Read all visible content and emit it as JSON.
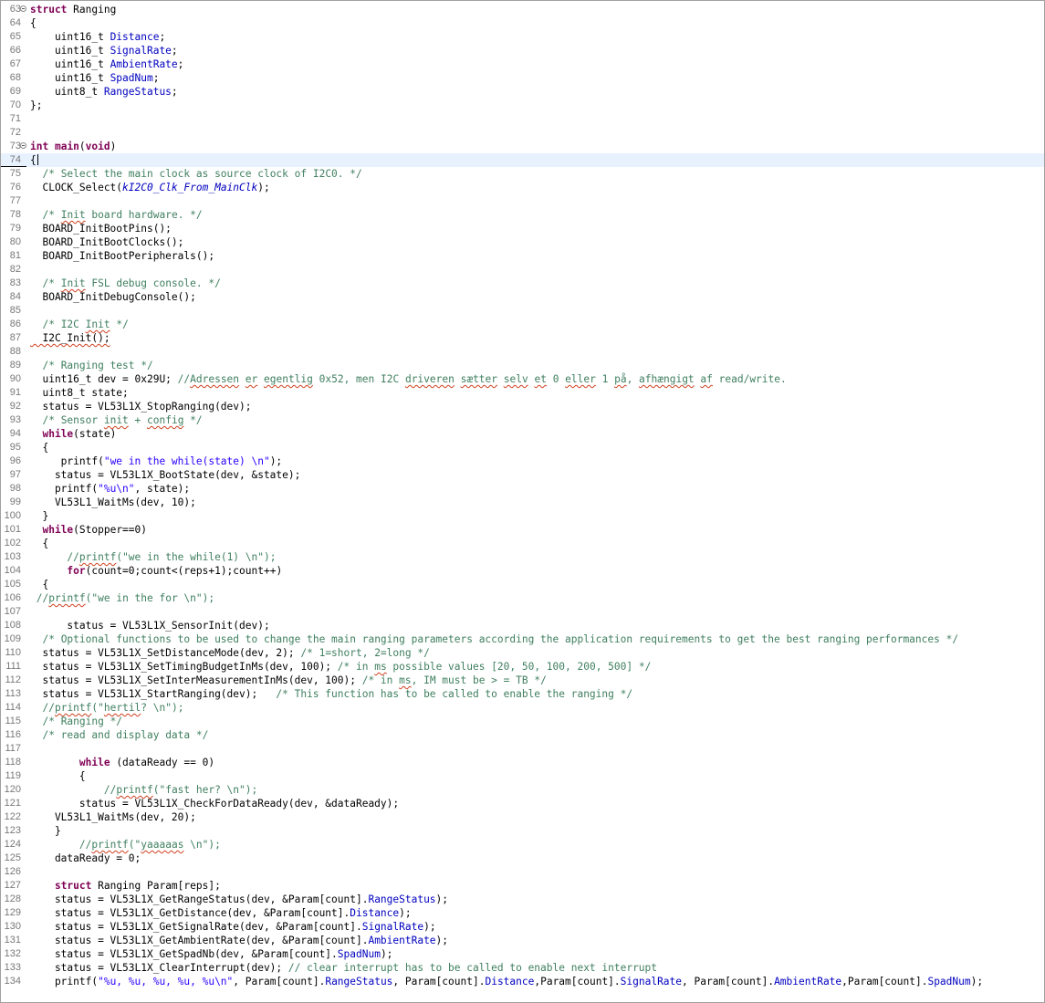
{
  "editor": {
    "current_line": 74,
    "lines": [
      {
        "n": "63",
        "fold": true,
        "t": [
          [
            "k",
            "struct"
          ],
          [
            "p",
            " Ranging"
          ]
        ]
      },
      {
        "n": "64",
        "t": [
          [
            "p",
            "{"
          ]
        ]
      },
      {
        "n": "65",
        "t": [
          [
            "p",
            "    uint16_t "
          ],
          [
            "f",
            "Distance"
          ],
          [
            "p",
            ";"
          ]
        ]
      },
      {
        "n": "66",
        "t": [
          [
            "p",
            "    uint16_t "
          ],
          [
            "f",
            "SignalRate"
          ],
          [
            "p",
            ";"
          ]
        ]
      },
      {
        "n": "67",
        "t": [
          [
            "p",
            "    uint16_t "
          ],
          [
            "f",
            "AmbientRate"
          ],
          [
            "p",
            ";"
          ]
        ]
      },
      {
        "n": "68",
        "t": [
          [
            "p",
            "    uint16_t "
          ],
          [
            "f",
            "SpadNum"
          ],
          [
            "p",
            ";"
          ]
        ]
      },
      {
        "n": "69",
        "t": [
          [
            "p",
            "    uint8_t "
          ],
          [
            "f",
            "RangeStatus"
          ],
          [
            "p",
            ";"
          ]
        ]
      },
      {
        "n": "70",
        "t": [
          [
            "p",
            "};"
          ]
        ]
      },
      {
        "n": "71",
        "t": []
      },
      {
        "n": "72",
        "t": []
      },
      {
        "n": "73",
        "fold": true,
        "t": [
          [
            "k",
            "int"
          ],
          [
            "p",
            " "
          ],
          [
            "k",
            "main"
          ],
          [
            "p",
            "("
          ],
          [
            "k",
            "void"
          ],
          [
            "p",
            ")"
          ]
        ]
      },
      {
        "n": "74",
        "bar": true,
        "caret": true,
        "t": [
          [
            "p",
            "{"
          ]
        ]
      },
      {
        "n": "75",
        "t": [
          [
            "p",
            "  "
          ],
          [
            "c",
            "/* Select the main clock as source clock of I2C0. */"
          ]
        ]
      },
      {
        "n": "76",
        "t": [
          [
            "p",
            "  CLOCK_Select("
          ],
          [
            "i",
            "kI2C0_Clk_From_MainClk"
          ],
          [
            "p",
            ");"
          ]
        ]
      },
      {
        "n": "77",
        "t": []
      },
      {
        "n": "78",
        "t": [
          [
            "p",
            "  "
          ],
          [
            "c",
            "/* "
          ],
          [
            "cw",
            "Init"
          ],
          [
            "c",
            " board hardware. */"
          ]
        ]
      },
      {
        "n": "79",
        "t": [
          [
            "p",
            "  BOARD_InitBootPins();"
          ]
        ]
      },
      {
        "n": "80",
        "t": [
          [
            "p",
            "  BOARD_InitBootClocks();"
          ]
        ]
      },
      {
        "n": "81",
        "t": [
          [
            "p",
            "  BOARD_InitBootPeripherals();"
          ]
        ]
      },
      {
        "n": "82",
        "t": []
      },
      {
        "n": "83",
        "t": [
          [
            "p",
            "  "
          ],
          [
            "c",
            "/* "
          ],
          [
            "cw",
            "Init"
          ],
          [
            "c",
            " FSL debug console. */"
          ]
        ]
      },
      {
        "n": "84",
        "t": [
          [
            "p",
            "  BOARD_InitDebugConsole();"
          ]
        ]
      },
      {
        "n": "85",
        "t": []
      },
      {
        "n": "86",
        "t": [
          [
            "p",
            "  "
          ],
          [
            "c",
            "/* I2C "
          ],
          [
            "cw",
            "Init"
          ],
          [
            "c",
            " */"
          ]
        ]
      },
      {
        "n": "87",
        "t": [
          [
            "pw",
            "  I2C_Init();"
          ]
        ]
      },
      {
        "n": "88",
        "t": []
      },
      {
        "n": "89",
        "t": [
          [
            "p",
            "  "
          ],
          [
            "c",
            "/* Ranging test */"
          ]
        ]
      },
      {
        "n": "90",
        "t": [
          [
            "p",
            "  uint16_t dev = 0x29U; "
          ],
          [
            "c",
            "//"
          ],
          [
            "cw",
            "Adressen"
          ],
          [
            "c",
            " "
          ],
          [
            "cw",
            "er"
          ],
          [
            "c",
            " "
          ],
          [
            "cw",
            "egentlig"
          ],
          [
            "c",
            " 0x52, men I2C "
          ],
          [
            "cw",
            "driveren"
          ],
          [
            "c",
            " "
          ],
          [
            "cw",
            "sætter"
          ],
          [
            "c",
            " "
          ],
          [
            "cw",
            "selv"
          ],
          [
            "c",
            " "
          ],
          [
            "cw",
            "et"
          ],
          [
            "c",
            " 0 "
          ],
          [
            "cw",
            "eller"
          ],
          [
            "c",
            " 1 "
          ],
          [
            "cw",
            "på"
          ],
          [
            "c",
            ", "
          ],
          [
            "cw",
            "afhængigt"
          ],
          [
            "c",
            " "
          ],
          [
            "cw",
            "af"
          ],
          [
            "c",
            " read/write."
          ]
        ]
      },
      {
        "n": "91",
        "t": [
          [
            "p",
            "  uint8_t state;"
          ]
        ]
      },
      {
        "n": "92",
        "t": [
          [
            "p",
            "  status = VL53L1X_StopRanging(dev);"
          ]
        ]
      },
      {
        "n": "93",
        "t": [
          [
            "p",
            "  "
          ],
          [
            "c",
            "/* Sensor "
          ],
          [
            "cw",
            "init"
          ],
          [
            "c",
            " + "
          ],
          [
            "cw",
            "config"
          ],
          [
            "c",
            " */"
          ]
        ]
      },
      {
        "n": "94",
        "t": [
          [
            "p",
            "  "
          ],
          [
            "k",
            "while"
          ],
          [
            "p",
            "(state)"
          ]
        ]
      },
      {
        "n": "95",
        "t": [
          [
            "p",
            "  {"
          ]
        ]
      },
      {
        "n": "96",
        "t": [
          [
            "p",
            "     printf("
          ],
          [
            "s",
            "\"we in the while(state) \\n\""
          ],
          [
            "p",
            ");"
          ]
        ]
      },
      {
        "n": "97",
        "t": [
          [
            "p",
            "    status = VL53L1X_BootState(dev, &state);"
          ]
        ]
      },
      {
        "n": "98",
        "t": [
          [
            "p",
            "    printf("
          ],
          [
            "s",
            "\"%u\\n\""
          ],
          [
            "p",
            ", state);"
          ]
        ]
      },
      {
        "n": "99",
        "t": [
          [
            "p",
            "    VL53L1_WaitMs(dev, 10);"
          ]
        ]
      },
      {
        "n": "100",
        "t": [
          [
            "p",
            "  }"
          ]
        ]
      },
      {
        "n": "101",
        "t": [
          [
            "p",
            "  "
          ],
          [
            "k",
            "while"
          ],
          [
            "p",
            "(Stopper==0)"
          ]
        ]
      },
      {
        "n": "102",
        "t": [
          [
            "p",
            "  {"
          ]
        ]
      },
      {
        "n": "103",
        "t": [
          [
            "p",
            "      "
          ],
          [
            "c",
            "//"
          ],
          [
            "cw",
            "printf"
          ],
          [
            "c",
            "(\"we in the while(1) \\n\");"
          ]
        ]
      },
      {
        "n": "104",
        "t": [
          [
            "p",
            "      "
          ],
          [
            "k",
            "for"
          ],
          [
            "p",
            "(count=0;count<(reps+1);count++)"
          ]
        ]
      },
      {
        "n": "105",
        "t": [
          [
            "p",
            "  {"
          ]
        ]
      },
      {
        "n": "106",
        "t": [
          [
            "p",
            " "
          ],
          [
            "c",
            "//"
          ],
          [
            "cw",
            "printf"
          ],
          [
            "c",
            "(\"we in the for \\n\");"
          ]
        ]
      },
      {
        "n": "107",
        "t": []
      },
      {
        "n": "108",
        "t": [
          [
            "p",
            "      status = VL53L1X_SensorInit(dev);"
          ]
        ]
      },
      {
        "n": "109",
        "t": [
          [
            "p",
            "  "
          ],
          [
            "c",
            "/* Optional functions to be used to change the main ranging parameters according the application requirements to get the best ranging performances */"
          ]
        ]
      },
      {
        "n": "110",
        "t": [
          [
            "p",
            "  status = VL53L1X_SetDistanceMode(dev, 2); "
          ],
          [
            "c",
            "/* 1=short, 2=long */"
          ]
        ]
      },
      {
        "n": "111",
        "t": [
          [
            "p",
            "  status = VL53L1X_SetTimingBudgetInMs(dev, 100); "
          ],
          [
            "c",
            "/* in "
          ],
          [
            "cw",
            "ms"
          ],
          [
            "c",
            " possible values [20, 50, 100, 200, 500] */"
          ]
        ]
      },
      {
        "n": "112",
        "t": [
          [
            "p",
            "  status = VL53L1X_SetInterMeasurementInMs(dev, 100); "
          ],
          [
            "c",
            "/* in "
          ],
          [
            "cw",
            "ms"
          ],
          [
            "c",
            ", IM must be > = TB */"
          ]
        ]
      },
      {
        "n": "113",
        "t": [
          [
            "p",
            "  status = VL53L1X_StartRanging(dev);   "
          ],
          [
            "c",
            "/* This function has to be called to enable the ranging */"
          ]
        ]
      },
      {
        "n": "114",
        "t": [
          [
            "p",
            "  "
          ],
          [
            "c",
            "//"
          ],
          [
            "cw",
            "printf"
          ],
          [
            "c",
            "(\""
          ],
          [
            "cw",
            "hertil"
          ],
          [
            "c",
            "? \\n\");"
          ]
        ]
      },
      {
        "n": "115",
        "t": [
          [
            "p",
            "  "
          ],
          [
            "c",
            "/* Ranging */"
          ]
        ]
      },
      {
        "n": "116",
        "t": [
          [
            "p",
            "  "
          ],
          [
            "c",
            "/* read and display data */"
          ]
        ]
      },
      {
        "n": "117",
        "t": []
      },
      {
        "n": "118",
        "t": [
          [
            "p",
            "        "
          ],
          [
            "k",
            "while"
          ],
          [
            "p",
            " (dataReady == 0)"
          ]
        ]
      },
      {
        "n": "119",
        "t": [
          [
            "p",
            "        {"
          ]
        ]
      },
      {
        "n": "120",
        "t": [
          [
            "p",
            "            "
          ],
          [
            "c",
            "//"
          ],
          [
            "cw",
            "printf"
          ],
          [
            "c",
            "(\"fast her? \\n\");"
          ]
        ]
      },
      {
        "n": "121",
        "t": [
          [
            "p",
            "        status = VL53L1X_CheckForDataReady(dev, &dataReady);"
          ]
        ]
      },
      {
        "n": "122",
        "t": [
          [
            "p",
            "    VL53L1_WaitMs(dev, 20);"
          ]
        ]
      },
      {
        "n": "123",
        "t": [
          [
            "p",
            "    }"
          ]
        ]
      },
      {
        "n": "124",
        "t": [
          [
            "p",
            "        "
          ],
          [
            "c",
            "//"
          ],
          [
            "cw",
            "printf"
          ],
          [
            "c",
            "(\""
          ],
          [
            "cw",
            "yaaaaas"
          ],
          [
            "c",
            " \\n\");"
          ]
        ]
      },
      {
        "n": "125",
        "t": [
          [
            "p",
            "    dataReady = 0;"
          ]
        ]
      },
      {
        "n": "126",
        "t": []
      },
      {
        "n": "127",
        "t": [
          [
            "p",
            "    "
          ],
          [
            "k",
            "struct"
          ],
          [
            "p",
            " Ranging Param[reps];"
          ]
        ]
      },
      {
        "n": "128",
        "t": [
          [
            "p",
            "    status = VL53L1X_GetRangeStatus(dev, &Param[count]."
          ],
          [
            "f",
            "RangeStatus"
          ],
          [
            "p",
            ");"
          ]
        ]
      },
      {
        "n": "129",
        "t": [
          [
            "p",
            "    status = VL53L1X_GetDistance(dev, &Param[count]."
          ],
          [
            "f",
            "Distance"
          ],
          [
            "p",
            ");"
          ]
        ]
      },
      {
        "n": "130",
        "t": [
          [
            "p",
            "    status = VL53L1X_GetSignalRate(dev, &Param[count]."
          ],
          [
            "f",
            "SignalRate"
          ],
          [
            "p",
            ");"
          ]
        ]
      },
      {
        "n": "131",
        "t": [
          [
            "p",
            "    status = VL53L1X_GetAmbientRate(dev, &Param[count]."
          ],
          [
            "f",
            "AmbientRate"
          ],
          [
            "p",
            ");"
          ]
        ]
      },
      {
        "n": "132",
        "t": [
          [
            "p",
            "    status = VL53L1X_GetSpadNb(dev, &Param[count]."
          ],
          [
            "f",
            "SpadNum"
          ],
          [
            "p",
            ");"
          ]
        ]
      },
      {
        "n": "133",
        "t": [
          [
            "p",
            "    status = VL53L1X_ClearInterrupt(dev); "
          ],
          [
            "c",
            "// clear interrupt has to be called to enable next interrupt"
          ]
        ]
      },
      {
        "n": "134",
        "t": [
          [
            "p",
            "    printf("
          ],
          [
            "s",
            "\"%u, %u, %u, %u, %u\\n\""
          ],
          [
            "p",
            ", Param[count]."
          ],
          [
            "f",
            "RangeStatus"
          ],
          [
            "p",
            ", Param[count]."
          ],
          [
            "f",
            "Distance"
          ],
          [
            "p",
            ",Param[count]."
          ],
          [
            "f",
            "SignalRate"
          ],
          [
            "p",
            ", Param[count]."
          ],
          [
            "f",
            "AmbientRate"
          ],
          [
            "p",
            ",Param[count]."
          ],
          [
            "f",
            "SpadNum"
          ],
          [
            "p",
            ");"
          ]
        ]
      }
    ]
  }
}
